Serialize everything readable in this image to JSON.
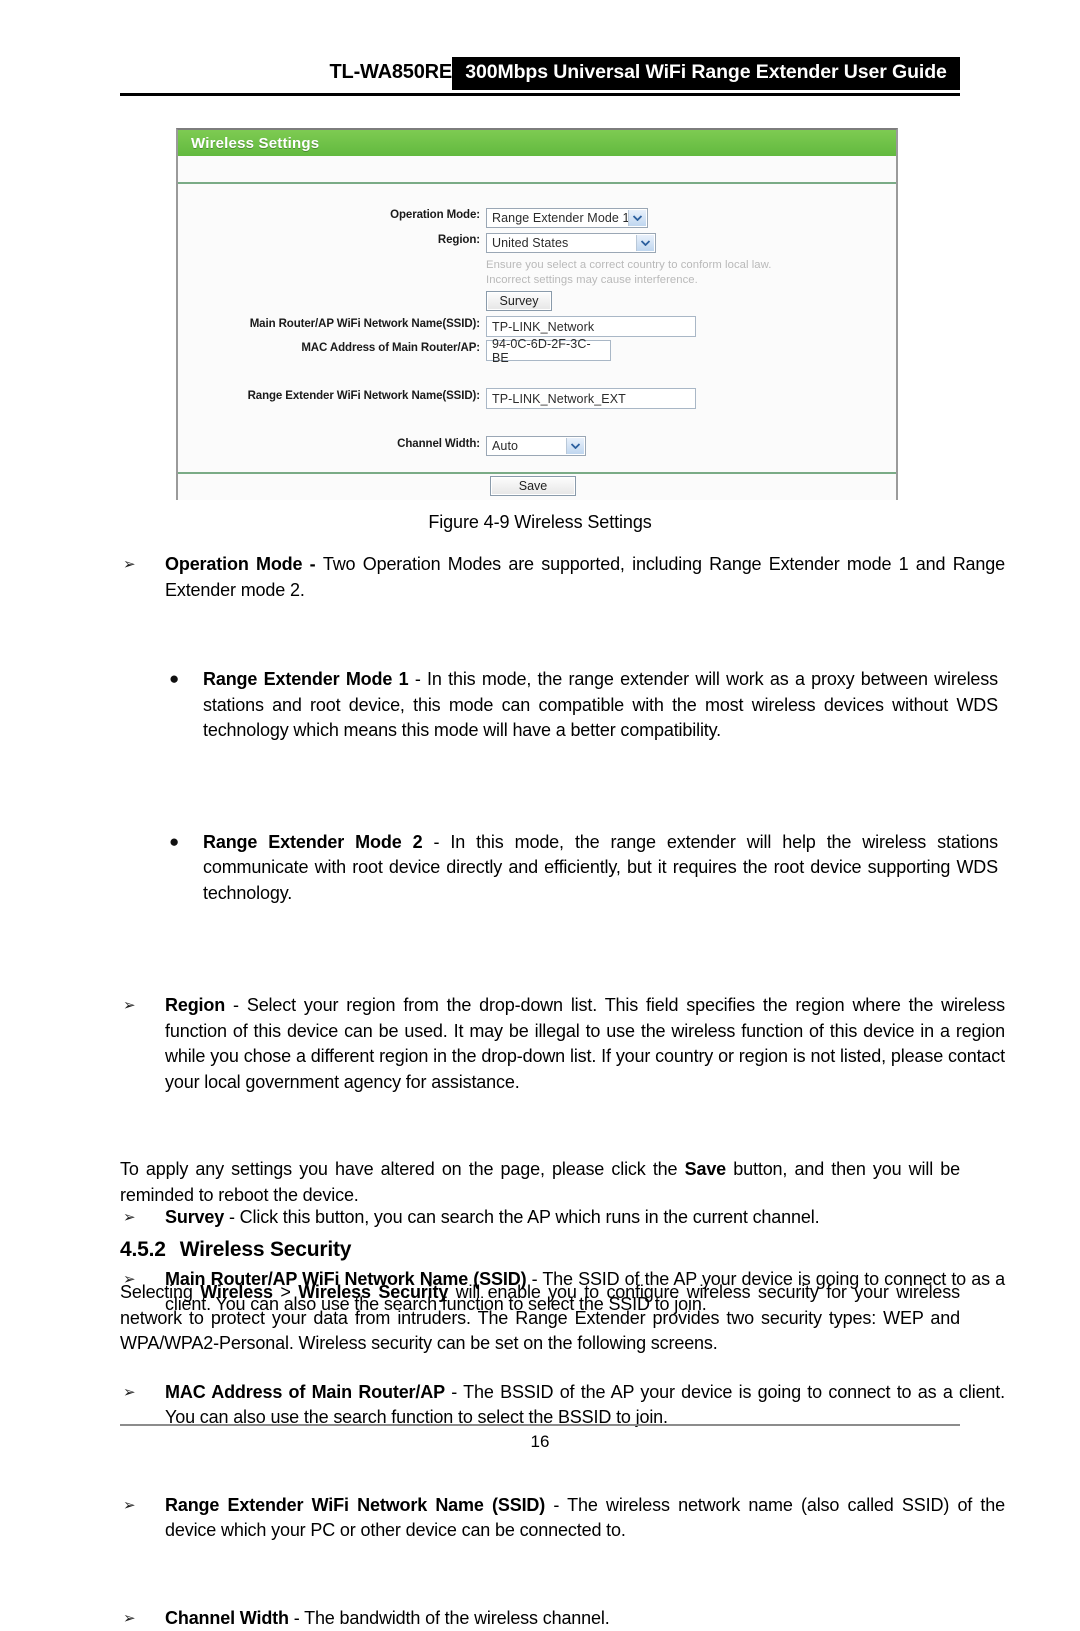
{
  "header": {
    "model": "TL-WA850RE",
    "title": "300Mbps Universal WiFi Range Extender User Guide"
  },
  "figure": {
    "panel_title": "Wireless Settings",
    "caption": "Figure 4-9 Wireless Settings",
    "accent_green": "#6cc04a",
    "fields": {
      "operation_mode_label": "Operation Mode:",
      "operation_mode_value": "Range Extender Mode 1",
      "region_label": "Region:",
      "region_value": "United States",
      "region_hint_line1": "Ensure you select a correct country to conform local law.",
      "region_hint_line2": "Incorrect settings may cause interference.",
      "survey_button": "Survey",
      "main_ssid_label": "Main Router/AP WiFi Network Name(SSID):",
      "main_ssid_value": "TP-LINK_Network",
      "mac_label": "MAC Address of Main Router/AP:",
      "mac_value": "94-0C-6D-2F-3C-BE",
      "ext_ssid_label": "Range Extender WiFi Network Name(SSID):",
      "ext_ssid_value": "TP-LINK_Network_EXT",
      "channel_width_label": "Channel Width:",
      "channel_width_value": "Auto",
      "save_button": "Save"
    }
  },
  "content": {
    "bullet_marker": "➢",
    "dot_marker": "●",
    "items": [
      {
        "term": "Operation Mode - ",
        "text": "Two Operation Modes are supported, including Range Extender mode 1 and Range Extender mode 2."
      },
      {
        "term": "Range Extender Mode 1",
        "text": " - In this mode, the range extender will work as a proxy between wireless stations and root device, this mode can compatible with the most wireless devices without WDS technology which means this mode will have a better compatibility."
      },
      {
        "term": "Range Extender Mode 2",
        "text": " - In this mode, the range extender will help the wireless stations communicate with root device directly and efficiently, but it requires the root device supporting WDS technology."
      },
      {
        "term": "Region",
        "text": " - Select your region from the drop-down list. This field specifies the region where the wireless function of this device can be used. It may be illegal to use the wireless function of this device in a region while you chose a different region in the drop-down list. If your country or region is not listed, please contact your local government agency for assistance."
      },
      {
        "term": "Survey",
        "text": " - Click this button, you can search the AP which runs in the current channel."
      },
      {
        "term": "Main Router/AP WiFi Network Name (SSID)",
        "text": " - The SSID of the AP your device is going to connect to as a client. You can also use the search function to select the SSID to join."
      },
      {
        "term": "MAC Address of Main Router/AP",
        "text": " - The BSSID of the AP your device is going to connect to as a client. You can also use the search function to select the BSSID to join."
      },
      {
        "term": "Range Extender WiFi Network Name (SSID)",
        "text": " - The wireless network name (also called SSID) of the device which your PC or other device can be connected to."
      },
      {
        "term": "Channel Width",
        "text": " - The bandwidth of the wireless channel."
      }
    ],
    "apply_para_pre": "To apply any settings you have altered on the page, please click the ",
    "apply_para_bold": "Save",
    "apply_para_post": " button, and then you will be reminded to reboot the device."
  },
  "section": {
    "number": "4.5.2",
    "title": "Wireless Security",
    "para_pre": "Selecting ",
    "para_bold1": "Wireless",
    "para_mid": " > ",
    "para_bold2": "Wireless Security",
    "para_post": " will enable you to configure wireless security for your wireless network to protect your data from intruders. The Range Extender provides two security types: WEP and WPA/WPA2-Personal. Wireless security can be set on the following screens."
  },
  "footer": {
    "page_number": "16"
  }
}
